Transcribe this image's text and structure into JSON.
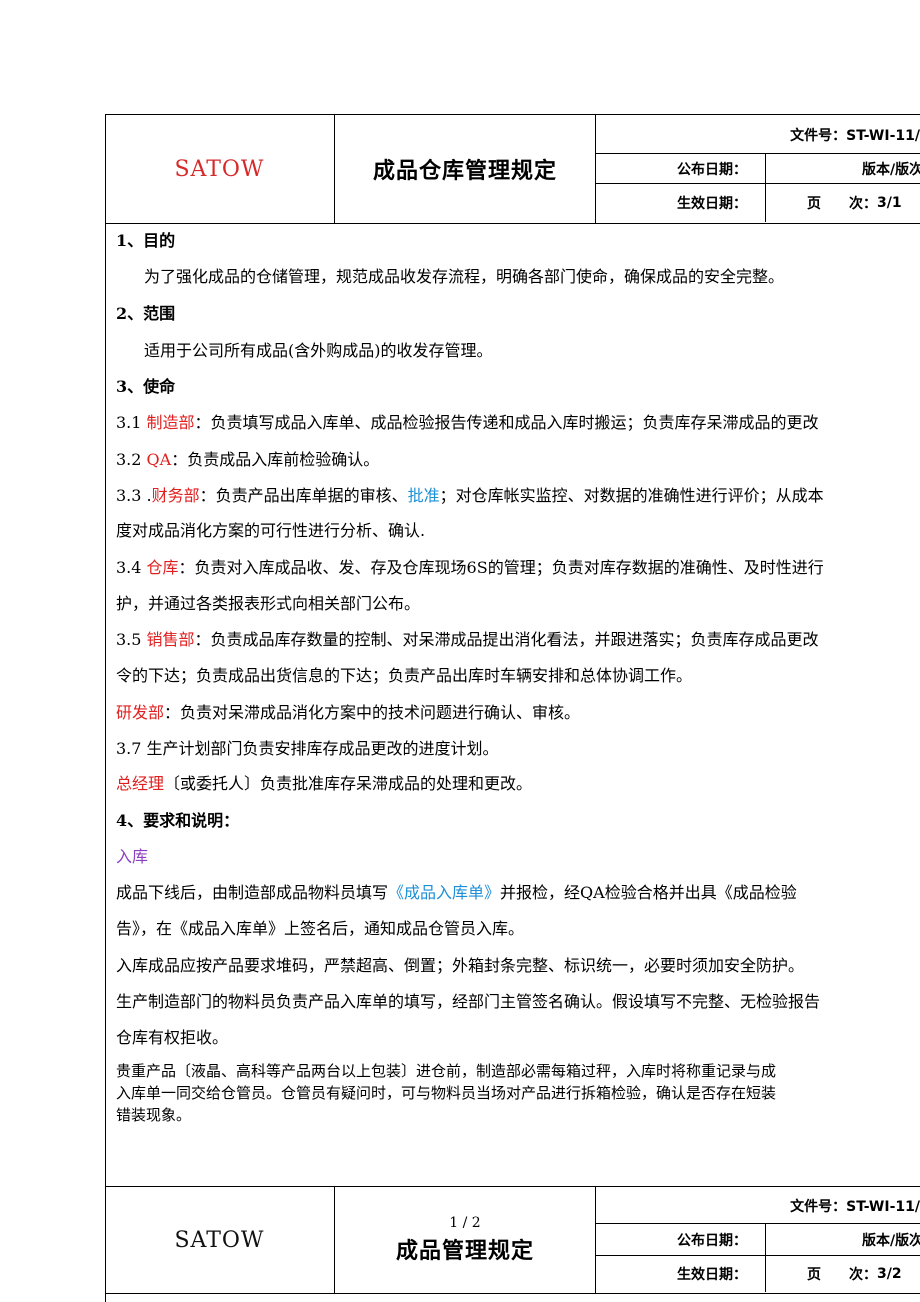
{
  "header": {
    "logo": "SATOW",
    "title": "成品仓库管理规定",
    "doc_no_label": "文件号：",
    "doc_no": "ST-WI-11/",
    "publish_label": "公布日期：",
    "version_label": "版本/版次",
    "effective_label": "生效日期：",
    "page_label": "页　　次：",
    "page_value": "3/1"
  },
  "footer_header": {
    "page_number": "1 / 2",
    "logo": "SATOW",
    "title": "成品管理规定",
    "doc_no_label": "文件号：",
    "doc_no": "ST-WI-11/",
    "publish_label": "公布日期：",
    "version_label": "版本/版次",
    "effective_label": "生效日期：",
    "page_label": "页　　次：",
    "page_value": "3/2"
  },
  "body": {
    "s1_title": "1、目的",
    "s1_text": "为了强化成品的仓储管理，规范成品收发存流程，明确各部门使命，确保成品的安全完整。",
    "s2_title": "2、范围",
    "s2_text": "适用于公司所有成品(含外购成品)的收发存管理。",
    "s3_title": "3、使命",
    "s31_num": "3.1 ",
    "s31_dept": "制造部",
    "s31_text": "：负责填写成品入库单、成品检验报告传递和成品入库时搬运；负责库存呆滞成品的更改",
    "s32_num": "3.2 ",
    "s32_dept": "QA",
    "s32_text": "：负责成品入库前检验确认。",
    "s33_num": "3.3 .",
    "s33_dept": "财务部",
    "s33_text_a": "：负责产品出库单据的审核、",
    "s33_approve": "批准",
    "s33_text_b": "；对仓库帐实监控、对数据的准确性进行评价；从成本",
    "s33_line2": "度对成品消化方案的可行性进行分析、确认.",
    "s34_num": "3.4 ",
    "s34_dept": "仓库",
    "s34_text": "：负责对入库成品收、发、存及仓库现场6S的管理；负责对库存数据的准确性、及时性进行",
    "s34_line2": "护，并通过各类报表形式向相关部门公布。",
    "s35_num": "3.5 ",
    "s35_dept": "销售部",
    "s35_text": "：负责成品库存数量的控制、对呆滞成品提出消化看法，并跟进落实；负责库存成品更改",
    "s35_line2": "令的下达；负责成品出货信息的下达；负责产品出库时车辆安排和总体协调工作。",
    "s36_dept": "研发部",
    "s36_text": "：负责对呆滞成品消化方案中的技术问题进行确认、审核。",
    "s37_text": "3.7 生产计划部门负责安排库存成品更改的进度计划。",
    "s38_dept": "总经理",
    "s38_text": "〔或委托人〕负责批准库存呆滞成品的处理和更改。",
    "s4_title": "4、要求和说明：",
    "inbound_title": "入库",
    "p1_a": "成品下线后，由制造部成品物料员填写",
    "p1_doc": "《成品入库单》",
    "p1_b": "并报检，经QA检验合格并出具《成品检验",
    "p1_line2": "告》，在《成品入库单》上签名后，通知成品仓管员入库。",
    "p2": "入库成品应按产品要求堆码，严禁超高、倒置；外箱封条完整、标识统一，必要时须加安全防护。",
    "p3_line1": "生产制造部门的物料员负责产品入库单的填写，经部门主管签名确认。假设填写不完整、无检验报告",
    "p3_line2": "仓库有权拒收。",
    "p4_line1": "贵重产品〔液晶、高科等产品两台以上包装〕进仓前，制造部必需每箱过秤，入库时将称重记录与成",
    "p4_line2": "入库单一同交给仓管员。仓管员有疑问时，可与物料员当场对产品进行拆箱检验，确认是否存在短装",
    "p4_line3": "错装现象。"
  }
}
